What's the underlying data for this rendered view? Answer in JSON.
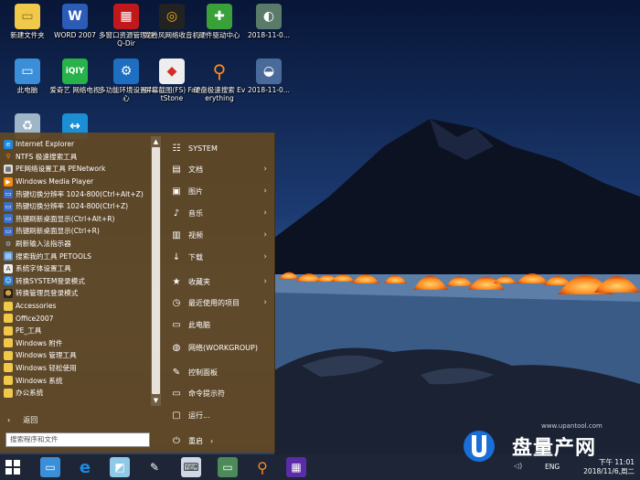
{
  "colors": {
    "menu_bg": "#624824",
    "taskbar_bg": "#1d2536",
    "tent_orange": "#ff8a22",
    "sky_top": "#0a1a40"
  },
  "desktop_icons": [
    {
      "label": "新建文件夹",
      "icon": "folder-icon"
    },
    {
      "label": "WORD 2007",
      "icon": "word-icon"
    },
    {
      "label": "多窗口资源管理器 Q-Dir",
      "icon": "qdir-icon"
    },
    {
      "label": "龙卷风网络收音机",
      "icon": "radio-icon"
    },
    {
      "label": "硬件驱动中心",
      "icon": "driver-icon"
    },
    {
      "label": "2018-11-0...",
      "icon": "image-file-icon"
    },
    {
      "label": "此电脑",
      "icon": "computer-icon"
    },
    {
      "label": "爱奇艺 网络电视",
      "icon": "iqiyi-icon"
    },
    {
      "label": "多功能环境设置中心",
      "icon": "gear-icon"
    },
    {
      "label": "屏幕截图(FS) FastStone",
      "icon": "faststone-icon"
    },
    {
      "label": "硬盘极速搜索 Everything",
      "icon": "search-icon"
    },
    {
      "label": "2018-11-0...",
      "icon": "image-file-icon"
    }
  ],
  "start_menu": {
    "programs": [
      {
        "label": "Internet Explorer",
        "icon": "ie-icon"
      },
      {
        "label": "NTFS 极速搜索工具",
        "icon": "search-icon"
      },
      {
        "label": "PE网络设置工具 PENetwork",
        "icon": "network-icon"
      },
      {
        "label": "Windows Media Player",
        "icon": "media-player-icon"
      },
      {
        "label": "热键切换分辨率 1024-800(Ctrl+Alt+Z)",
        "icon": "monitor-icon"
      },
      {
        "label": "热键切换分辨率 1024-800(Ctrl+Z)",
        "icon": "monitor-icon"
      },
      {
        "label": "热键刷新桌面显示(Ctrl+Alt+R)",
        "icon": "monitor-icon"
      },
      {
        "label": "热键刷新桌面显示(Ctrl+R)",
        "icon": "monitor-icon"
      },
      {
        "label": "刷新输入法指示器",
        "icon": "gear-icon"
      },
      {
        "label": "搜索我的工具 PETOOLS",
        "icon": "tools-icon"
      },
      {
        "label": "系统字体设置工具",
        "icon": "font-icon"
      },
      {
        "label": "转换SYSTEM登录模式",
        "icon": "user-icon"
      },
      {
        "label": "转换管理员登录模式",
        "icon": "admin-icon"
      },
      {
        "label": "Accessories",
        "icon": "folder-icon"
      },
      {
        "label": "Office2007",
        "icon": "folder-icon"
      },
      {
        "label": "PE_工具",
        "icon": "folder-icon"
      },
      {
        "label": "Windows 附件",
        "icon": "folder-icon"
      },
      {
        "label": "Windows 管理工具",
        "icon": "folder-icon"
      },
      {
        "label": "Windows 轻松使用",
        "icon": "folder-icon"
      },
      {
        "label": "Windows 系统",
        "icon": "folder-icon"
      },
      {
        "label": "办公系统",
        "icon": "folder-icon"
      }
    ],
    "back_label": "返回",
    "search_placeholder": "搜索程序和文件",
    "right_items": [
      {
        "label": "SYSTEM",
        "icon": "user-icon",
        "submenu": false
      },
      {
        "label": "文档",
        "icon": "document-icon",
        "submenu": true
      },
      {
        "label": "图片",
        "icon": "picture-icon",
        "submenu": true
      },
      {
        "label": "音乐",
        "icon": "music-icon",
        "submenu": true
      },
      {
        "label": "视频",
        "icon": "video-icon",
        "submenu": true
      },
      {
        "label": "下载",
        "icon": "download-icon",
        "submenu": true
      },
      {
        "label": "收藏夹",
        "icon": "star-icon",
        "submenu": true
      },
      {
        "label": "最近使用的项目",
        "icon": "clock-icon",
        "submenu": true
      },
      {
        "label": "此电脑",
        "icon": "computer-icon",
        "submenu": false
      },
      {
        "label": "网络(WORKGROUP)",
        "icon": "globe-icon",
        "submenu": false
      },
      {
        "label": "控制面板",
        "icon": "wrench-icon",
        "submenu": false
      },
      {
        "label": "命令提示符",
        "icon": "cmd-icon",
        "submenu": false
      },
      {
        "label": "运行...",
        "icon": "run-icon",
        "submenu": false
      },
      {
        "label": "重启",
        "icon": "power-icon",
        "submenu": true
      }
    ]
  },
  "taskbar": {
    "lang": "ENG",
    "time": "下午 11:01",
    "date": "2018/11/6,周二"
  },
  "watermark": {
    "text": "盘量产网",
    "url": "www.upantool.com"
  }
}
